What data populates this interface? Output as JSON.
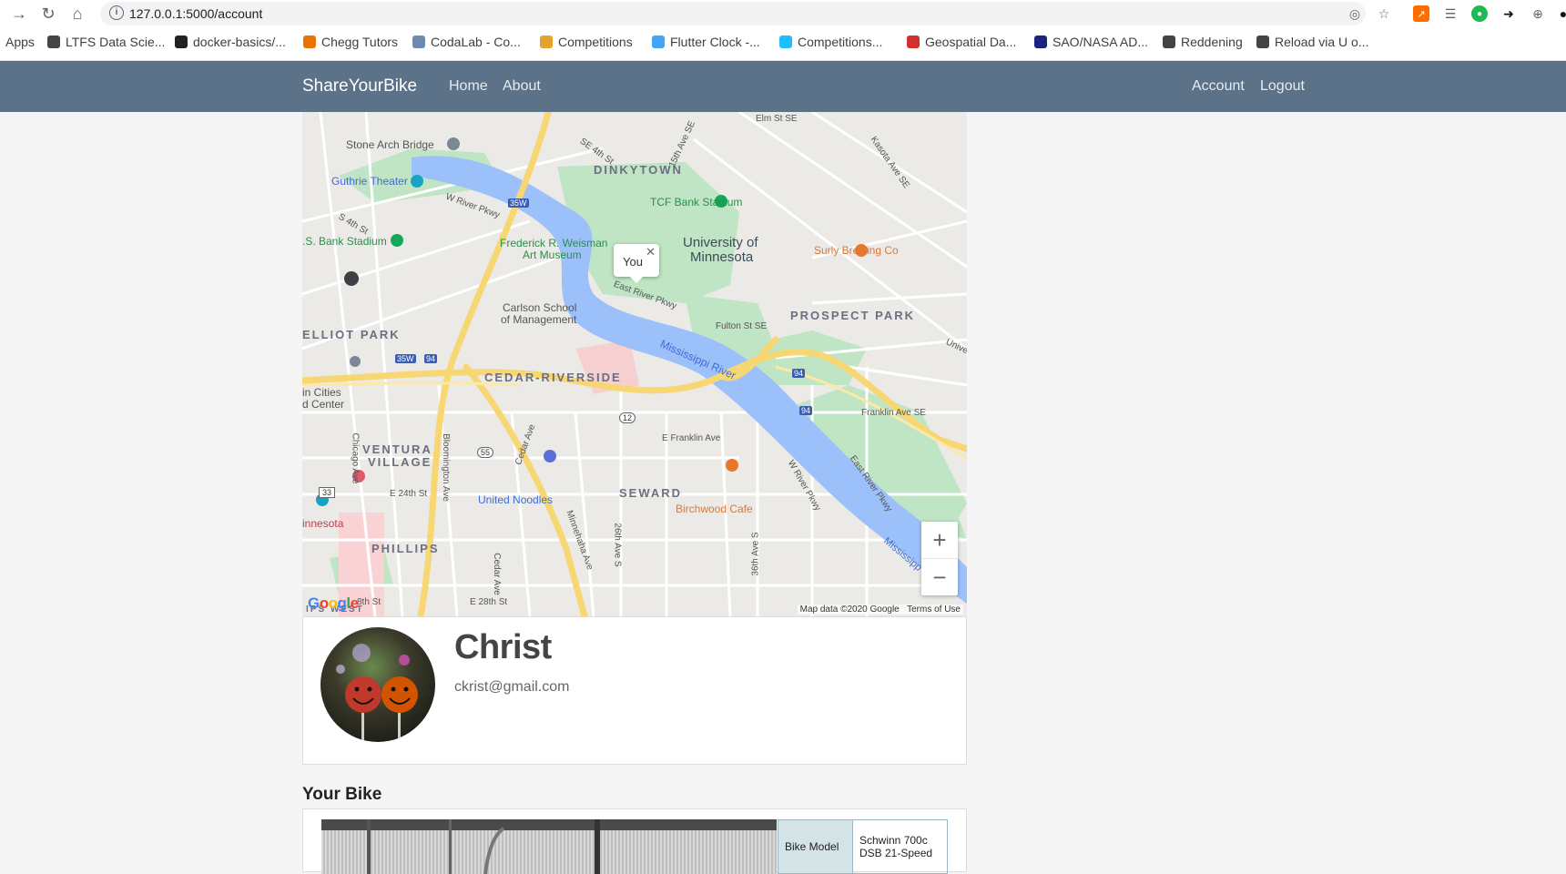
{
  "browser": {
    "url": "127.0.0.1:5000/account",
    "bookmarks": [
      {
        "label": "Apps",
        "icon": "apps-grid-icon",
        "color": "#4285f4"
      },
      {
        "label": "LTFS Data Scie...",
        "icon": "globe-icon",
        "color": "#444444"
      },
      {
        "label": "docker-basics/...",
        "icon": "github-icon",
        "color": "#222222"
      },
      {
        "label": "Chegg Tutors",
        "icon": "chegg-icon",
        "color": "#eb7100"
      },
      {
        "label": "CodaLab - Co...",
        "icon": "codalab-icon",
        "color": "#6d8ab0"
      },
      {
        "label": "Competitions",
        "icon": "competitions-icon",
        "color": "#e5a12b"
      },
      {
        "label": "Flutter Clock -...",
        "icon": "flutter-icon",
        "color": "#42a5f5"
      },
      {
        "label": "Competitions...",
        "icon": "kaggle-icon",
        "color": "#20beff"
      },
      {
        "label": "Geospatial Da...",
        "icon": "info-icon",
        "color": "#d32f2f"
      },
      {
        "label": "SAO/NASA AD...",
        "icon": "ads-icon",
        "color": "#1a237e"
      },
      {
        "label": "Reddening",
        "icon": "globe-icon",
        "color": "#444444"
      },
      {
        "label": "Reload via U o...",
        "icon": "globe-icon",
        "color": "#444444"
      }
    ]
  },
  "nav": {
    "brand": "ShareYourBike",
    "home": "Home",
    "about": "About",
    "account": "Account",
    "logout": "Logout"
  },
  "map": {
    "popup_label": "You",
    "labels": {
      "stone_arch": "Stone Arch Bridge",
      "dinkytown": "DINKYTOWN",
      "guthrie": "Guthrie Theater",
      "tcf": "TCF Bank Stadium",
      "usbank": ".S. Bank Stadium",
      "weisman": "Frederick R. Weisman",
      "weisman2": "Art Museum",
      "umn": "University of",
      "umn2": "Minnesota",
      "surly": "Surly Brewing Co",
      "carlson": "Carlson School",
      "carlson2": "of Management",
      "elliot": "ELLIOT PARK",
      "prospect": "PROSPECT PARK",
      "fulton": "Fulton St SE",
      "mississippi": "Mississippi River",
      "cedar": "CEDAR-RIVERSIDE",
      "twin": "in Cities",
      "twin2": "d Center",
      "franklin_se": "Franklin Ave SE",
      "efranklin": "E Franklin Ave",
      "ventura": "VENTURA",
      "ventura2": "VILLAGE",
      "seward": "SEWARD",
      "noodles": "United Noodles",
      "birchwood": "Birchwood Cafe",
      "e24": "E 24th St",
      "innesota": "innesota",
      "phillips": "PHILLIPS",
      "e28": "E 28th St",
      "elm": "Elm St SE",
      "kasota": "Kasota Ave SE",
      "se4": "SE 4th St",
      "ave15": "15th Ave SE",
      "wriver": "W River Pkwy",
      "s4": "S 4th St",
      "eriver": "East River Pkwy",
      "chicago": "Chicago Ave",
      "bloomington": "Bloomington Ave",
      "cedarave": "Cedar Ave",
      "minnehaha": "Minnehaha Ave",
      "ave26": "26th Ave S",
      "ave36": "36th Ave S",
      "wrivpkwy2": "W River Pkwy",
      "erivpkwy2": "East River Pkwy",
      "univ": "Univer",
      "miss2": "Mississipp",
      "ips_west": "IPS WEST",
      "th8": "8th St"
    },
    "shields": [
      "35W",
      "35W",
      "94",
      "94",
      "94",
      "12",
      "55",
      "33"
    ],
    "zoom_in": "+",
    "zoom_out": "−",
    "google": "Google",
    "attribution": "Map data ©2020 Google",
    "terms": "Terms of Use"
  },
  "profile": {
    "name": "Christ",
    "email": "ckrist@gmail.com"
  },
  "bike": {
    "heading": "Your Bike",
    "model_key": "Bike Model",
    "model_value": "Schwinn 700c DSB 21-Speed"
  }
}
